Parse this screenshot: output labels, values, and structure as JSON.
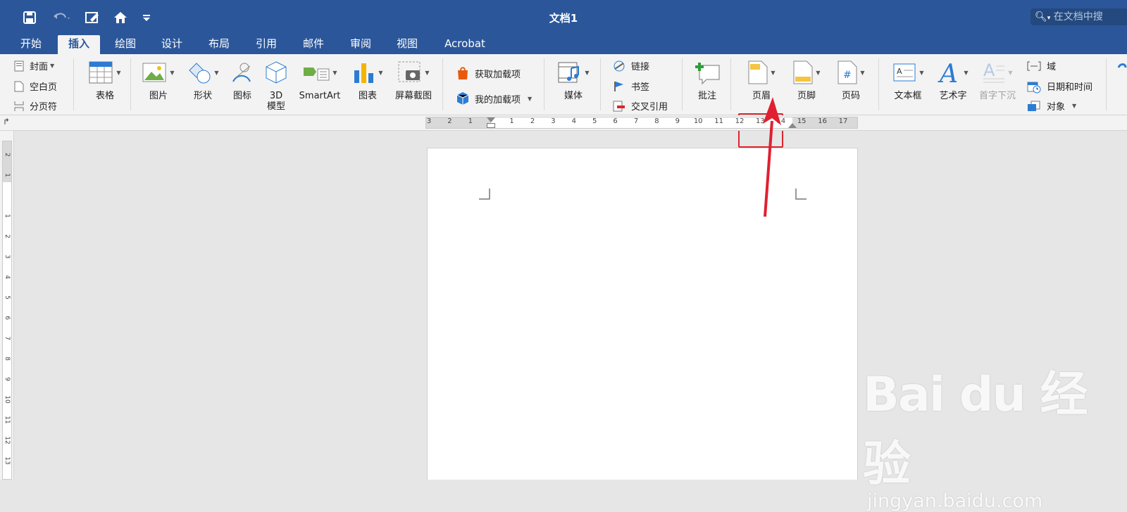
{
  "window": {
    "title": "文档1"
  },
  "search": {
    "placeholder": "在文档中搜"
  },
  "tabs": [
    {
      "label": "开始"
    },
    {
      "label": "插入"
    },
    {
      "label": "绘图"
    },
    {
      "label": "设计"
    },
    {
      "label": "布局"
    },
    {
      "label": "引用"
    },
    {
      "label": "邮件"
    },
    {
      "label": "审阅"
    },
    {
      "label": "视图"
    },
    {
      "label": "Acrobat"
    }
  ],
  "active_tab": "插入",
  "pages_group": {
    "cover": "封面",
    "blank": "空白页",
    "page_break": "分页符"
  },
  "table": {
    "label": "表格"
  },
  "illustrations": {
    "picture": "图片",
    "shapes": "形状",
    "icons": "图标",
    "model3d": "3D\n模型",
    "smartart": "SmartArt",
    "chart": "图表",
    "screenshot": "屏幕截图"
  },
  "addins": {
    "get": "获取加载项",
    "mine": "我的加载项"
  },
  "media": {
    "label": "媒体"
  },
  "links": {
    "link": "链接",
    "bookmark": "书签",
    "cross_ref": "交叉引用"
  },
  "comment": {
    "label": "批注"
  },
  "header_footer": {
    "header": "页眉",
    "footer": "页脚",
    "page_number": "页码"
  },
  "text_group": {
    "textbox": "文本框",
    "wordart": "艺术字",
    "dropcap": "首字下沉",
    "field": "域",
    "datetime": "日期和时间",
    "object": "对象"
  },
  "ruler": {
    "numbers": [
      "3",
      "2",
      "1",
      "1",
      "2",
      "3",
      "4",
      "5",
      "6",
      "7",
      "8",
      "9",
      "10",
      "11",
      "12",
      "13",
      "14",
      "15",
      "16",
      "17"
    ]
  },
  "vruler": {
    "numbers": [
      "2",
      "1",
      "1",
      "2",
      "3",
      "4",
      "5",
      "6",
      "7",
      "8",
      "9",
      "10",
      "11",
      "12",
      "13"
    ]
  },
  "watermark": {
    "logo": "Bai du 经验",
    "url": "jingyan.baidu.com"
  },
  "colors": {
    "accent": "#2b579a",
    "highlight": "#d9272e",
    "arrow": "#e02030"
  },
  "icons": [
    "save-icon",
    "undo-icon",
    "edit-icon",
    "home-icon",
    "customize-icon",
    "search-icon"
  ]
}
